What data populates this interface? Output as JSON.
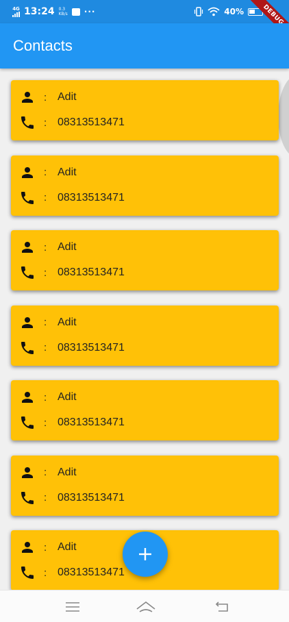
{
  "status_bar": {
    "network": "4G",
    "time": "13:24",
    "speed_value": "0.3",
    "speed_unit": "KB/s",
    "more": "···",
    "battery": "40%",
    "icons": [
      "signal-icon",
      "sim-badge-icon",
      "vibrate-icon",
      "wifi-icon",
      "battery-icon"
    ]
  },
  "debug_banner": "DEBUG",
  "app_bar": {
    "title": "Contacts"
  },
  "contacts": [
    {
      "name": "Adit",
      "phone": "08313513471"
    },
    {
      "name": "Adit",
      "phone": "08313513471"
    },
    {
      "name": "Adit",
      "phone": "08313513471"
    },
    {
      "name": "Adit",
      "phone": "08313513471"
    },
    {
      "name": "Adit",
      "phone": "08313513471"
    },
    {
      "name": "Adit",
      "phone": "08313513471"
    },
    {
      "name": "Adit",
      "phone": "08313513471"
    }
  ],
  "separator": ":",
  "fab": {
    "icon": "plus-icon"
  },
  "nav": {
    "icons": [
      "menu-icon",
      "home-icon",
      "back-icon"
    ]
  },
  "colors": {
    "primary": "#2196f3",
    "status_bar": "#1f8ae0",
    "card": "#ffc107",
    "background": "#f0f0f0",
    "debug": "#b01717"
  }
}
